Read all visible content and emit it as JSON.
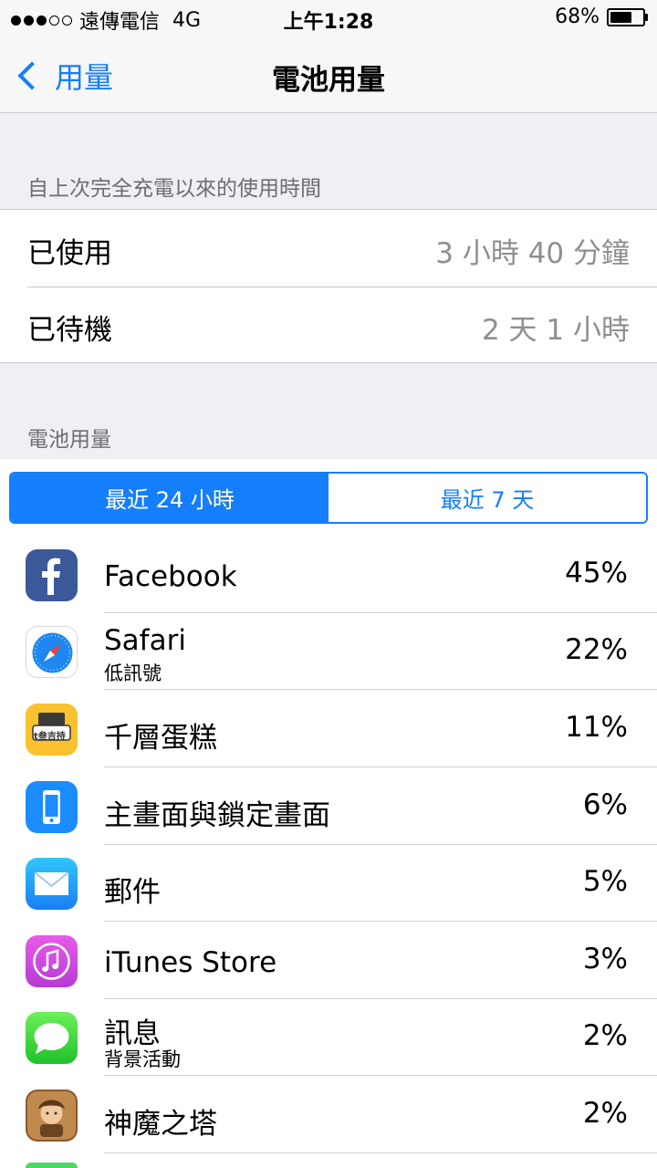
{
  "status_bar": {
    "carrier": "遠傳電信",
    "network": "4G",
    "time": "上午1:28",
    "battery_percent": "68%",
    "battery_level": 0.68
  },
  "nav": {
    "back_label": "用量",
    "title": "電池用量"
  },
  "usage_section": {
    "header": "自上次完全充電以來的使用時間",
    "rows": [
      {
        "label": "已使用",
        "value": "3 小時 40 分鐘"
      },
      {
        "label": "已待機",
        "value": "2 天 1 小時"
      }
    ]
  },
  "battery_section": {
    "header": "電池用量",
    "segments": [
      "最近 24 小時",
      "最近 7 天"
    ],
    "selected_segment": 0
  },
  "apps": [
    {
      "name": "Facebook",
      "sub": "",
      "percent": "45%",
      "icon": "facebook-icon"
    },
    {
      "name": "Safari",
      "sub": "低訊號",
      "percent": "22%",
      "icon": "safari-icon"
    },
    {
      "name": "千層蛋糕",
      "sub": "",
      "percent": "11%",
      "icon": "cake-game-icon",
      "icon_text": "t叁吉持"
    },
    {
      "name": "主畫面與鎖定畫面",
      "sub": "",
      "percent": "6%",
      "icon": "phone-icon"
    },
    {
      "name": "郵件",
      "sub": "",
      "percent": "5%",
      "icon": "mail-icon"
    },
    {
      "name": "iTunes Store",
      "sub": "",
      "percent": "3%",
      "icon": "itunes-icon"
    },
    {
      "name": "訊息",
      "sub": "背景活動",
      "percent": "2%",
      "icon": "messages-icon"
    },
    {
      "name": "神魔之塔",
      "sub": "",
      "percent": "2%",
      "icon": "tower-game-icon"
    }
  ],
  "colors": {
    "accent": "#157efb",
    "background": "#efeff4",
    "secondary_text": "#8e8e93"
  }
}
